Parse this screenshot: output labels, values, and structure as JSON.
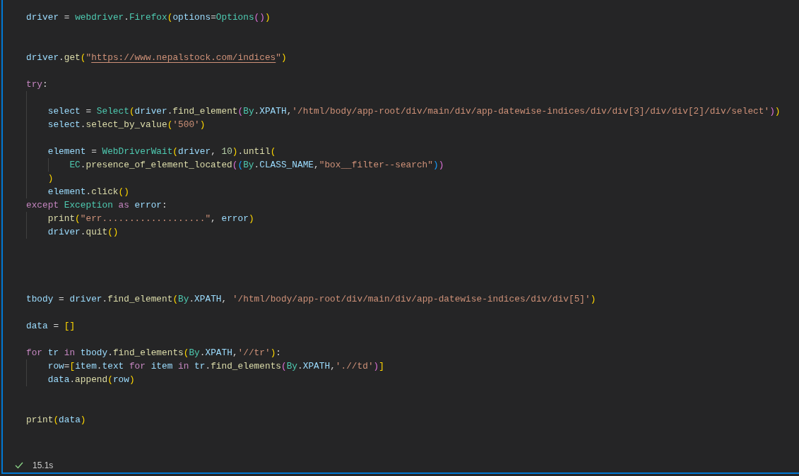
{
  "code_lines": [
    {
      "kind": "code",
      "tokens": [
        {
          "text": "driver",
          "kind": "variable"
        },
        {
          "text": " = ",
          "kind": "plain"
        },
        {
          "text": "webdriver",
          "kind": "class"
        },
        {
          "text": ".",
          "kind": "plain"
        },
        {
          "text": "Firefox",
          "kind": "class"
        },
        {
          "text": "(",
          "kind": "bracket1"
        },
        {
          "text": "options",
          "kind": "variable"
        },
        {
          "text": "=",
          "kind": "plain"
        },
        {
          "text": "Options",
          "kind": "class"
        },
        {
          "text": "()",
          "kind": "bracket2"
        },
        {
          "text": ")",
          "kind": "bracket1"
        }
      ]
    },
    {
      "kind": "blank"
    },
    {
      "kind": "blank"
    },
    {
      "kind": "code",
      "tokens": [
        {
          "text": "driver",
          "kind": "variable"
        },
        {
          "text": ".",
          "kind": "plain"
        },
        {
          "text": "get",
          "kind": "function"
        },
        {
          "text": "(",
          "kind": "bracket1"
        },
        {
          "text": "\"",
          "kind": "string"
        },
        {
          "text": "https://www.nepalstock.com/indices",
          "kind": "link"
        },
        {
          "text": "\"",
          "kind": "string"
        },
        {
          "text": ")",
          "kind": "bracket1"
        }
      ]
    },
    {
      "kind": "blank"
    },
    {
      "kind": "code",
      "tokens": [
        {
          "text": "try",
          "kind": "keyword"
        },
        {
          "text": ":",
          "kind": "plain"
        }
      ],
      "children": [
        {
          "kind": "blank"
        },
        {
          "kind": "code",
          "tokens": [
            {
              "text": "select",
              "kind": "variable"
            },
            {
              "text": " = ",
              "kind": "plain"
            },
            {
              "text": "Select",
              "kind": "class"
            },
            {
              "text": "(",
              "kind": "bracket1"
            },
            {
              "text": "driver",
              "kind": "variable"
            },
            {
              "text": ".",
              "kind": "plain"
            },
            {
              "text": "find_element",
              "kind": "function"
            },
            {
              "text": "(",
              "kind": "bracket2"
            },
            {
              "text": "By",
              "kind": "class"
            },
            {
              "text": ".",
              "kind": "plain"
            },
            {
              "text": "XPATH",
              "kind": "variable"
            },
            {
              "text": ",",
              "kind": "plain"
            },
            {
              "text": "'/html/body/app-root/div/main/div/app-datewise-indices/div/div[3]/div/div[2]/div/select'",
              "kind": "string"
            },
            {
              "text": ")",
              "kind": "bracket2"
            },
            {
              "text": ")",
              "kind": "bracket1"
            }
          ]
        },
        {
          "kind": "code",
          "tokens": [
            {
              "text": "select",
              "kind": "variable"
            },
            {
              "text": ".",
              "kind": "plain"
            },
            {
              "text": "select_by_value",
              "kind": "function"
            },
            {
              "text": "(",
              "kind": "bracket1"
            },
            {
              "text": "'500'",
              "kind": "string"
            },
            {
              "text": ")",
              "kind": "bracket1"
            }
          ]
        },
        {
          "kind": "blank"
        },
        {
          "kind": "code",
          "tokens": [
            {
              "text": "element",
              "kind": "variable"
            },
            {
              "text": " = ",
              "kind": "plain"
            },
            {
              "text": "WebDriverWait",
              "kind": "class"
            },
            {
              "text": "(",
              "kind": "bracket1"
            },
            {
              "text": "driver",
              "kind": "variable"
            },
            {
              "text": ", ",
              "kind": "plain"
            },
            {
              "text": "10",
              "kind": "number"
            },
            {
              "text": ")",
              "kind": "bracket1"
            },
            {
              "text": ".",
              "kind": "plain"
            },
            {
              "text": "until",
              "kind": "function"
            },
            {
              "text": "(",
              "kind": "bracket1"
            }
          ],
          "children": [
            {
              "kind": "code",
              "tokens": [
                {
                  "text": "EC",
                  "kind": "class"
                },
                {
                  "text": ".",
                  "kind": "plain"
                },
                {
                  "text": "presence_of_element_located",
                  "kind": "function"
                },
                {
                  "text": "(",
                  "kind": "bracket2"
                },
                {
                  "text": "(",
                  "kind": "bracket3"
                },
                {
                  "text": "By",
                  "kind": "class"
                },
                {
                  "text": ".",
                  "kind": "plain"
                },
                {
                  "text": "CLASS_NAME",
                  "kind": "variable"
                },
                {
                  "text": ",",
                  "kind": "plain"
                },
                {
                  "text": "\"box__filter--search\"",
                  "kind": "string"
                },
                {
                  "text": ")",
                  "kind": "bracket3"
                },
                {
                  "text": ")",
                  "kind": "bracket2"
                }
              ]
            }
          ]
        },
        {
          "kind": "code",
          "tokens": [
            {
              "text": ")",
              "kind": "bracket1"
            }
          ]
        },
        {
          "kind": "code",
          "tokens": [
            {
              "text": "element",
              "kind": "variable"
            },
            {
              "text": ".",
              "kind": "plain"
            },
            {
              "text": "click",
              "kind": "function"
            },
            {
              "text": "()",
              "kind": "bracket1"
            }
          ]
        }
      ]
    },
    {
      "kind": "code",
      "tokens": [
        {
          "text": "except",
          "kind": "keyword"
        },
        {
          "text": " Exception",
          "kind": "class"
        },
        {
          "text": " as",
          "kind": "keyword"
        },
        {
          "text": " error",
          "kind": "variable"
        },
        {
          "text": ":",
          "kind": "plain"
        }
      ],
      "children": [
        {
          "kind": "code",
          "tokens": [
            {
              "text": "print",
              "kind": "function"
            },
            {
              "text": "(",
              "kind": "bracket1"
            },
            {
              "text": "\"err...................\"",
              "kind": "string"
            },
            {
              "text": ", ",
              "kind": "plain"
            },
            {
              "text": "error",
              "kind": "variable"
            },
            {
              "text": ")",
              "kind": "bracket1"
            }
          ]
        },
        {
          "kind": "code",
          "tokens": [
            {
              "text": "driver",
              "kind": "variable"
            },
            {
              "text": ".",
              "kind": "plain"
            },
            {
              "text": "quit",
              "kind": "function"
            },
            {
              "text": "()",
              "kind": "bracket1"
            }
          ]
        }
      ]
    },
    {
      "kind": "blank"
    },
    {
      "kind": "blank"
    },
    {
      "kind": "blank"
    },
    {
      "kind": "blank"
    },
    {
      "kind": "code",
      "tokens": [
        {
          "text": "tbody",
          "kind": "variable"
        },
        {
          "text": " = ",
          "kind": "plain"
        },
        {
          "text": "driver",
          "kind": "variable"
        },
        {
          "text": ".",
          "kind": "plain"
        },
        {
          "text": "find_element",
          "kind": "function"
        },
        {
          "text": "(",
          "kind": "bracket1"
        },
        {
          "text": "By",
          "kind": "class"
        },
        {
          "text": ".",
          "kind": "plain"
        },
        {
          "text": "XPATH",
          "kind": "variable"
        },
        {
          "text": ", ",
          "kind": "plain"
        },
        {
          "text": "'/html/body/app-root/div/main/div/app-datewise-indices/div/div[5]'",
          "kind": "string"
        },
        {
          "text": ")",
          "kind": "bracket1"
        }
      ]
    },
    {
      "kind": "blank"
    },
    {
      "kind": "code",
      "tokens": [
        {
          "text": "data",
          "kind": "variable"
        },
        {
          "text": " = ",
          "kind": "plain"
        },
        {
          "text": "[]",
          "kind": "bracket1"
        }
      ]
    },
    {
      "kind": "blank"
    },
    {
      "kind": "code",
      "tokens": [
        {
          "text": "for",
          "kind": "keyword"
        },
        {
          "text": " tr",
          "kind": "variable"
        },
        {
          "text": " in",
          "kind": "keyword"
        },
        {
          "text": " tbody",
          "kind": "variable"
        },
        {
          "text": ".",
          "kind": "plain"
        },
        {
          "text": "find_elements",
          "kind": "function"
        },
        {
          "text": "(",
          "kind": "bracket1"
        },
        {
          "text": "By",
          "kind": "class"
        },
        {
          "text": ".",
          "kind": "plain"
        },
        {
          "text": "XPATH",
          "kind": "variable"
        },
        {
          "text": ",",
          "kind": "plain"
        },
        {
          "text": "'//tr'",
          "kind": "string"
        },
        {
          "text": ")",
          "kind": "bracket1"
        },
        {
          "text": ":",
          "kind": "plain"
        }
      ],
      "children": [
        {
          "kind": "code",
          "tokens": [
            {
              "text": "row",
              "kind": "variable"
            },
            {
              "text": "=",
              "kind": "plain"
            },
            {
              "text": "[",
              "kind": "bracket1"
            },
            {
              "text": "item",
              "kind": "variable"
            },
            {
              "text": ".",
              "kind": "plain"
            },
            {
              "text": "text",
              "kind": "variable"
            },
            {
              "text": " for",
              "kind": "keyword"
            },
            {
              "text": " item",
              "kind": "variable"
            },
            {
              "text": " in",
              "kind": "keyword"
            },
            {
              "text": " tr",
              "kind": "variable"
            },
            {
              "text": ".",
              "kind": "plain"
            },
            {
              "text": "find_elements",
              "kind": "function"
            },
            {
              "text": "(",
              "kind": "bracket2"
            },
            {
              "text": "By",
              "kind": "class"
            },
            {
              "text": ".",
              "kind": "plain"
            },
            {
              "text": "XPATH",
              "kind": "variable"
            },
            {
              "text": ",",
              "kind": "plain"
            },
            {
              "text": "'.//td'",
              "kind": "string"
            },
            {
              "text": ")",
              "kind": "bracket2"
            },
            {
              "text": "]",
              "kind": "bracket1"
            }
          ]
        },
        {
          "kind": "code",
          "tokens": [
            {
              "text": "data",
              "kind": "variable"
            },
            {
              "text": ".",
              "kind": "plain"
            },
            {
              "text": "append",
              "kind": "function"
            },
            {
              "text": "(",
              "kind": "bracket1"
            },
            {
              "text": "row",
              "kind": "variable"
            },
            {
              "text": ")",
              "kind": "bracket1"
            }
          ]
        }
      ]
    },
    {
      "kind": "blank"
    },
    {
      "kind": "blank"
    },
    {
      "kind": "code",
      "tokens": [
        {
          "text": "print",
          "kind": "function"
        },
        {
          "text": "(",
          "kind": "bracket1"
        },
        {
          "text": "data",
          "kind": "variable"
        },
        {
          "text": ")",
          "kind": "bracket1"
        }
      ]
    }
  ],
  "status": {
    "succeeded": true,
    "duration": "15.1s"
  }
}
